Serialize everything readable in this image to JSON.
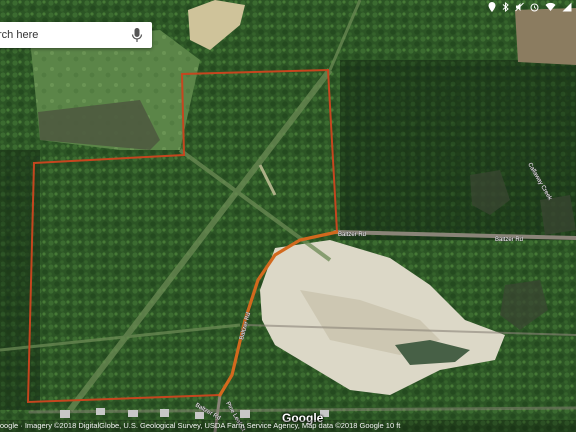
{
  "search": {
    "placeholder_visible": "rch here",
    "mic_icon": "microphone-icon"
  },
  "status_icons": [
    "location-pin-icon",
    "bluetooth-icon",
    "mute-icon",
    "alarm-icon",
    "wifi-icon",
    "signal-icon"
  ],
  "labels": {
    "road_baltzer_east": "Baltzer Rd",
    "road_baltzer_far_east": "Baltzer Rd",
    "road_baltzer_south": "Baltzer Rd",
    "road_baltzer_bottom": "Baltzer Rd",
    "road_pine_leaf": "Pine Leaf Ct",
    "creek": "Callaway Creek"
  },
  "logo": "Google",
  "attribution": "Google · Imagery ©2018 DigitalGlobe, U.S. Geological Survey, USDA Farm Service Agency, Map data ©2018 Google    10 ft",
  "colors": {
    "forest_dark": "#1e3d1a",
    "forest": "#2f5a27",
    "field": "#4d7a3c",
    "quarry": "#d9d6c8",
    "road": "#8a8478",
    "boundary": "#c5461f",
    "highlighted_road": "#d2691e"
  }
}
